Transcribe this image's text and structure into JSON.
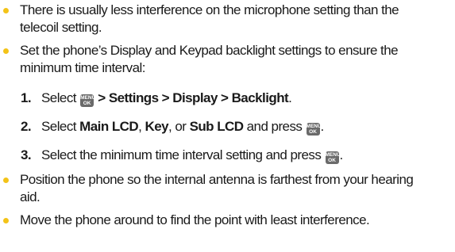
{
  "bullets": [
    {
      "line1": "There is usually less interference on the microphone setting than the",
      "line2": "telecoil setting."
    },
    {
      "line1": "Set the phone’s Display and Keypad backlight settings to ensure the",
      "line2": "minimum time interval:"
    },
    {
      "line1": "Position the phone so the internal antenna is farthest from your hearing",
      "line2": "aid."
    },
    {
      "line1": "Move the phone around to find the point with least interference."
    }
  ],
  "steps": [
    {
      "num": "1.",
      "prefix": "Select ",
      "path": " > Settings > Display > Backlight",
      "suffix": "."
    },
    {
      "num": "2.",
      "prefix": "Select ",
      "opt1": "Main LCD",
      "sep1": ", ",
      "opt2": "Key",
      "sep2": ", or ",
      "opt3": "Sub LCD",
      "mid": " and press ",
      "suffix": "."
    },
    {
      "num": "3.",
      "text": "Select the minimum time interval setting and press ",
      "suffix": "."
    }
  ],
  "key": {
    "top": "MENU",
    "bottom": "OK"
  },
  "colors": {
    "bullet": "#f3c318",
    "key_bg": "#6a6a6a"
  }
}
